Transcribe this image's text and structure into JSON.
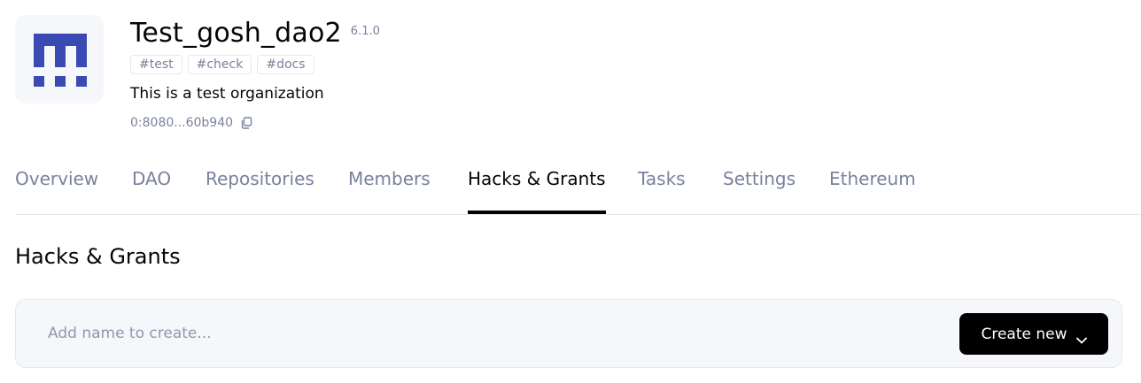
{
  "dao": {
    "name": "Test_gosh_dao2",
    "version": "6.1.0",
    "tags": [
      "#test",
      "#check",
      "#docs"
    ],
    "description": "This is a test organization",
    "address": "0:8080...60b940"
  },
  "tabs": [
    {
      "label": "Overview"
    },
    {
      "label": "DAO"
    },
    {
      "label": "Repositories"
    },
    {
      "label": "Members"
    },
    {
      "label": "Hacks & Grants"
    },
    {
      "label": "Tasks"
    },
    {
      "label": "Settings"
    },
    {
      "label": "Ethereum"
    }
  ],
  "active_tab": "Hacks & Grants",
  "section": {
    "title": "Hacks & Grants",
    "input_placeholder": "Add name to create...",
    "create_button_label": "Create new"
  },
  "colors": {
    "accent": "#3a4ab3",
    "muted_text": "#7b819d",
    "primary_text": "#050505",
    "button_bg": "#000000"
  },
  "icons": {
    "avatar": "dao-logo-icon",
    "copy": "copy-icon",
    "dropdown": "chevron-down-icon"
  }
}
